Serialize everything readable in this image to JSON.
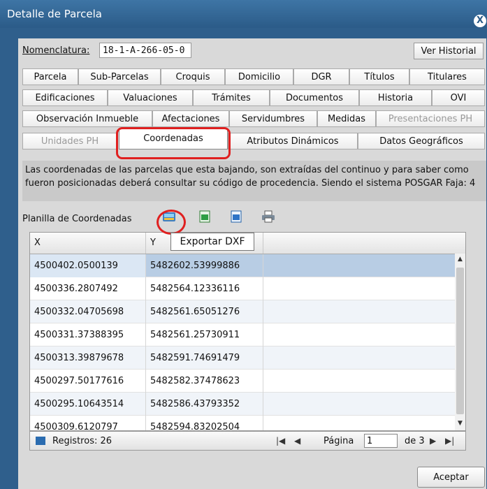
{
  "window": {
    "title": "Detalle de Parcela",
    "close_glyph": "X"
  },
  "nomenclatura": {
    "label": "Nomenclatura:",
    "value": "18-1-A-266-05-0",
    "history_button": "Ver Historial"
  },
  "tabs": {
    "row1": [
      "Parcela",
      "Sub-Parcelas",
      "Croquis",
      "Domicilio",
      "DGR",
      "Títulos",
      "Titulares"
    ],
    "row2": [
      "Edificaciones",
      "Valuaciones",
      "Trámites",
      "Documentos",
      "Historia",
      "OVI"
    ],
    "row3": [
      "Observación Inmueble",
      "Afectaciones",
      "Servidumbres",
      "Medidas",
      "Presentaciones PH"
    ],
    "row4": [
      "Unidades PH",
      "Coordenadas",
      "Atributos Dinámicos",
      "Datos Geográficos"
    ],
    "active": "Coordenadas"
  },
  "info_text": "Las coordenadas de las parcelas que esta bajando, son extraídas del continuo y para saber como fueron posicionadas deberá consultar su código de procedencia. Siendo el sistema POSGAR Faja: 4",
  "toolbar": {
    "label": "Planilla de Coordenadas",
    "tooltip": "Exportar DXF",
    "icons": [
      "export-dxf-icon",
      "excel-export-icon",
      "word-export-icon",
      "print-icon"
    ]
  },
  "grid": {
    "columns": [
      "X",
      "Y"
    ],
    "rows": [
      [
        "4500402.0500139",
        "5482602.53999886"
      ],
      [
        "4500336.2807492",
        "5482564.12336116"
      ],
      [
        "4500332.04705698",
        "5482561.65051276"
      ],
      [
        "4500331.37388395",
        "5482561.25730911"
      ],
      [
        "4500313.39879678",
        "5482591.74691479"
      ],
      [
        "4500297.50177616",
        "5482582.37478623"
      ],
      [
        "4500295.10643514",
        "5482586.43793352"
      ],
      [
        "4500309.6120797",
        "5482594.83202504"
      ]
    ]
  },
  "pager": {
    "records_label": "Registros: 26",
    "page_label": "Página",
    "page_value": "1",
    "of_label": "de 3"
  },
  "footer": {
    "accept_button": "Aceptar"
  },
  "colors": {
    "title_bar": "#2f5f8c",
    "highlight": "#e02020",
    "selected_row": "#b8cde4"
  }
}
